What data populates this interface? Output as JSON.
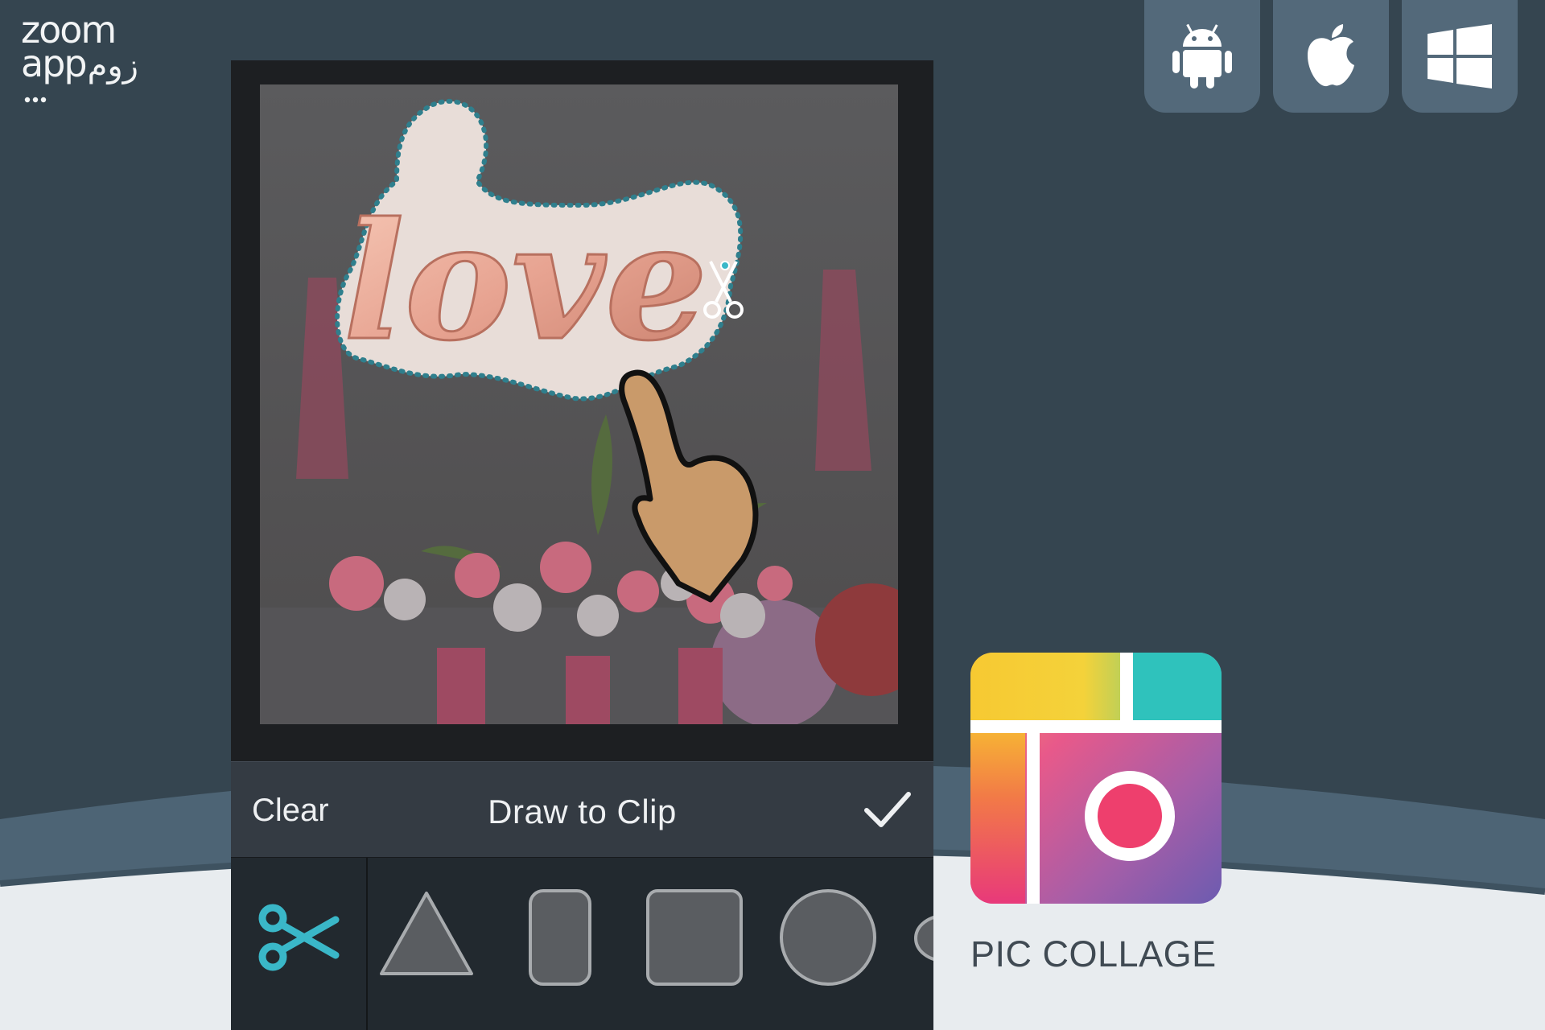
{
  "logo": {
    "line1": "zoom",
    "line2": "app",
    "line2_farsi": "زوم"
  },
  "platforms": [
    {
      "name": "android-icon"
    },
    {
      "name": "apple-icon"
    },
    {
      "name": "windows-icon"
    }
  ],
  "editor": {
    "clear_label": "Clear",
    "title": "Draw to Clip",
    "confirm_icon": "checkmark-icon",
    "tools": [
      "scissors-icon",
      "triangle-shape",
      "rounded-rectangle-shape",
      "square-shape",
      "circle-shape",
      "ellipse-shape"
    ],
    "photo_text": "love"
  },
  "app": {
    "name": "PIC COLLAGE"
  },
  "colors": {
    "background": "#354550",
    "accent_teal": "#3ab7c8",
    "platform_button": "#53697a",
    "toolbar": "#22292f"
  }
}
